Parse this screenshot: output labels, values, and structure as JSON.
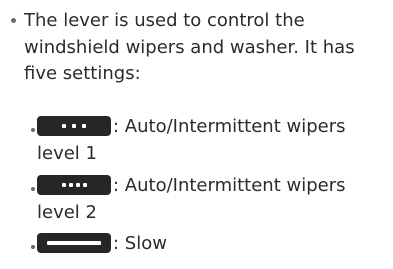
{
  "intro": {
    "text": "The lever is used to control the windshield wipers and washer. It has five settings:"
  },
  "settings": [
    {
      "icon": "wiper-dots-spaced-icon",
      "label": ": Auto/Intermittent wipers level 1"
    },
    {
      "icon": "wiper-dots-tight-icon",
      "label": ": Auto/Intermittent wipers level 2"
    },
    {
      "icon": "wiper-slow-line-icon",
      "label": ": Slow"
    }
  ]
}
